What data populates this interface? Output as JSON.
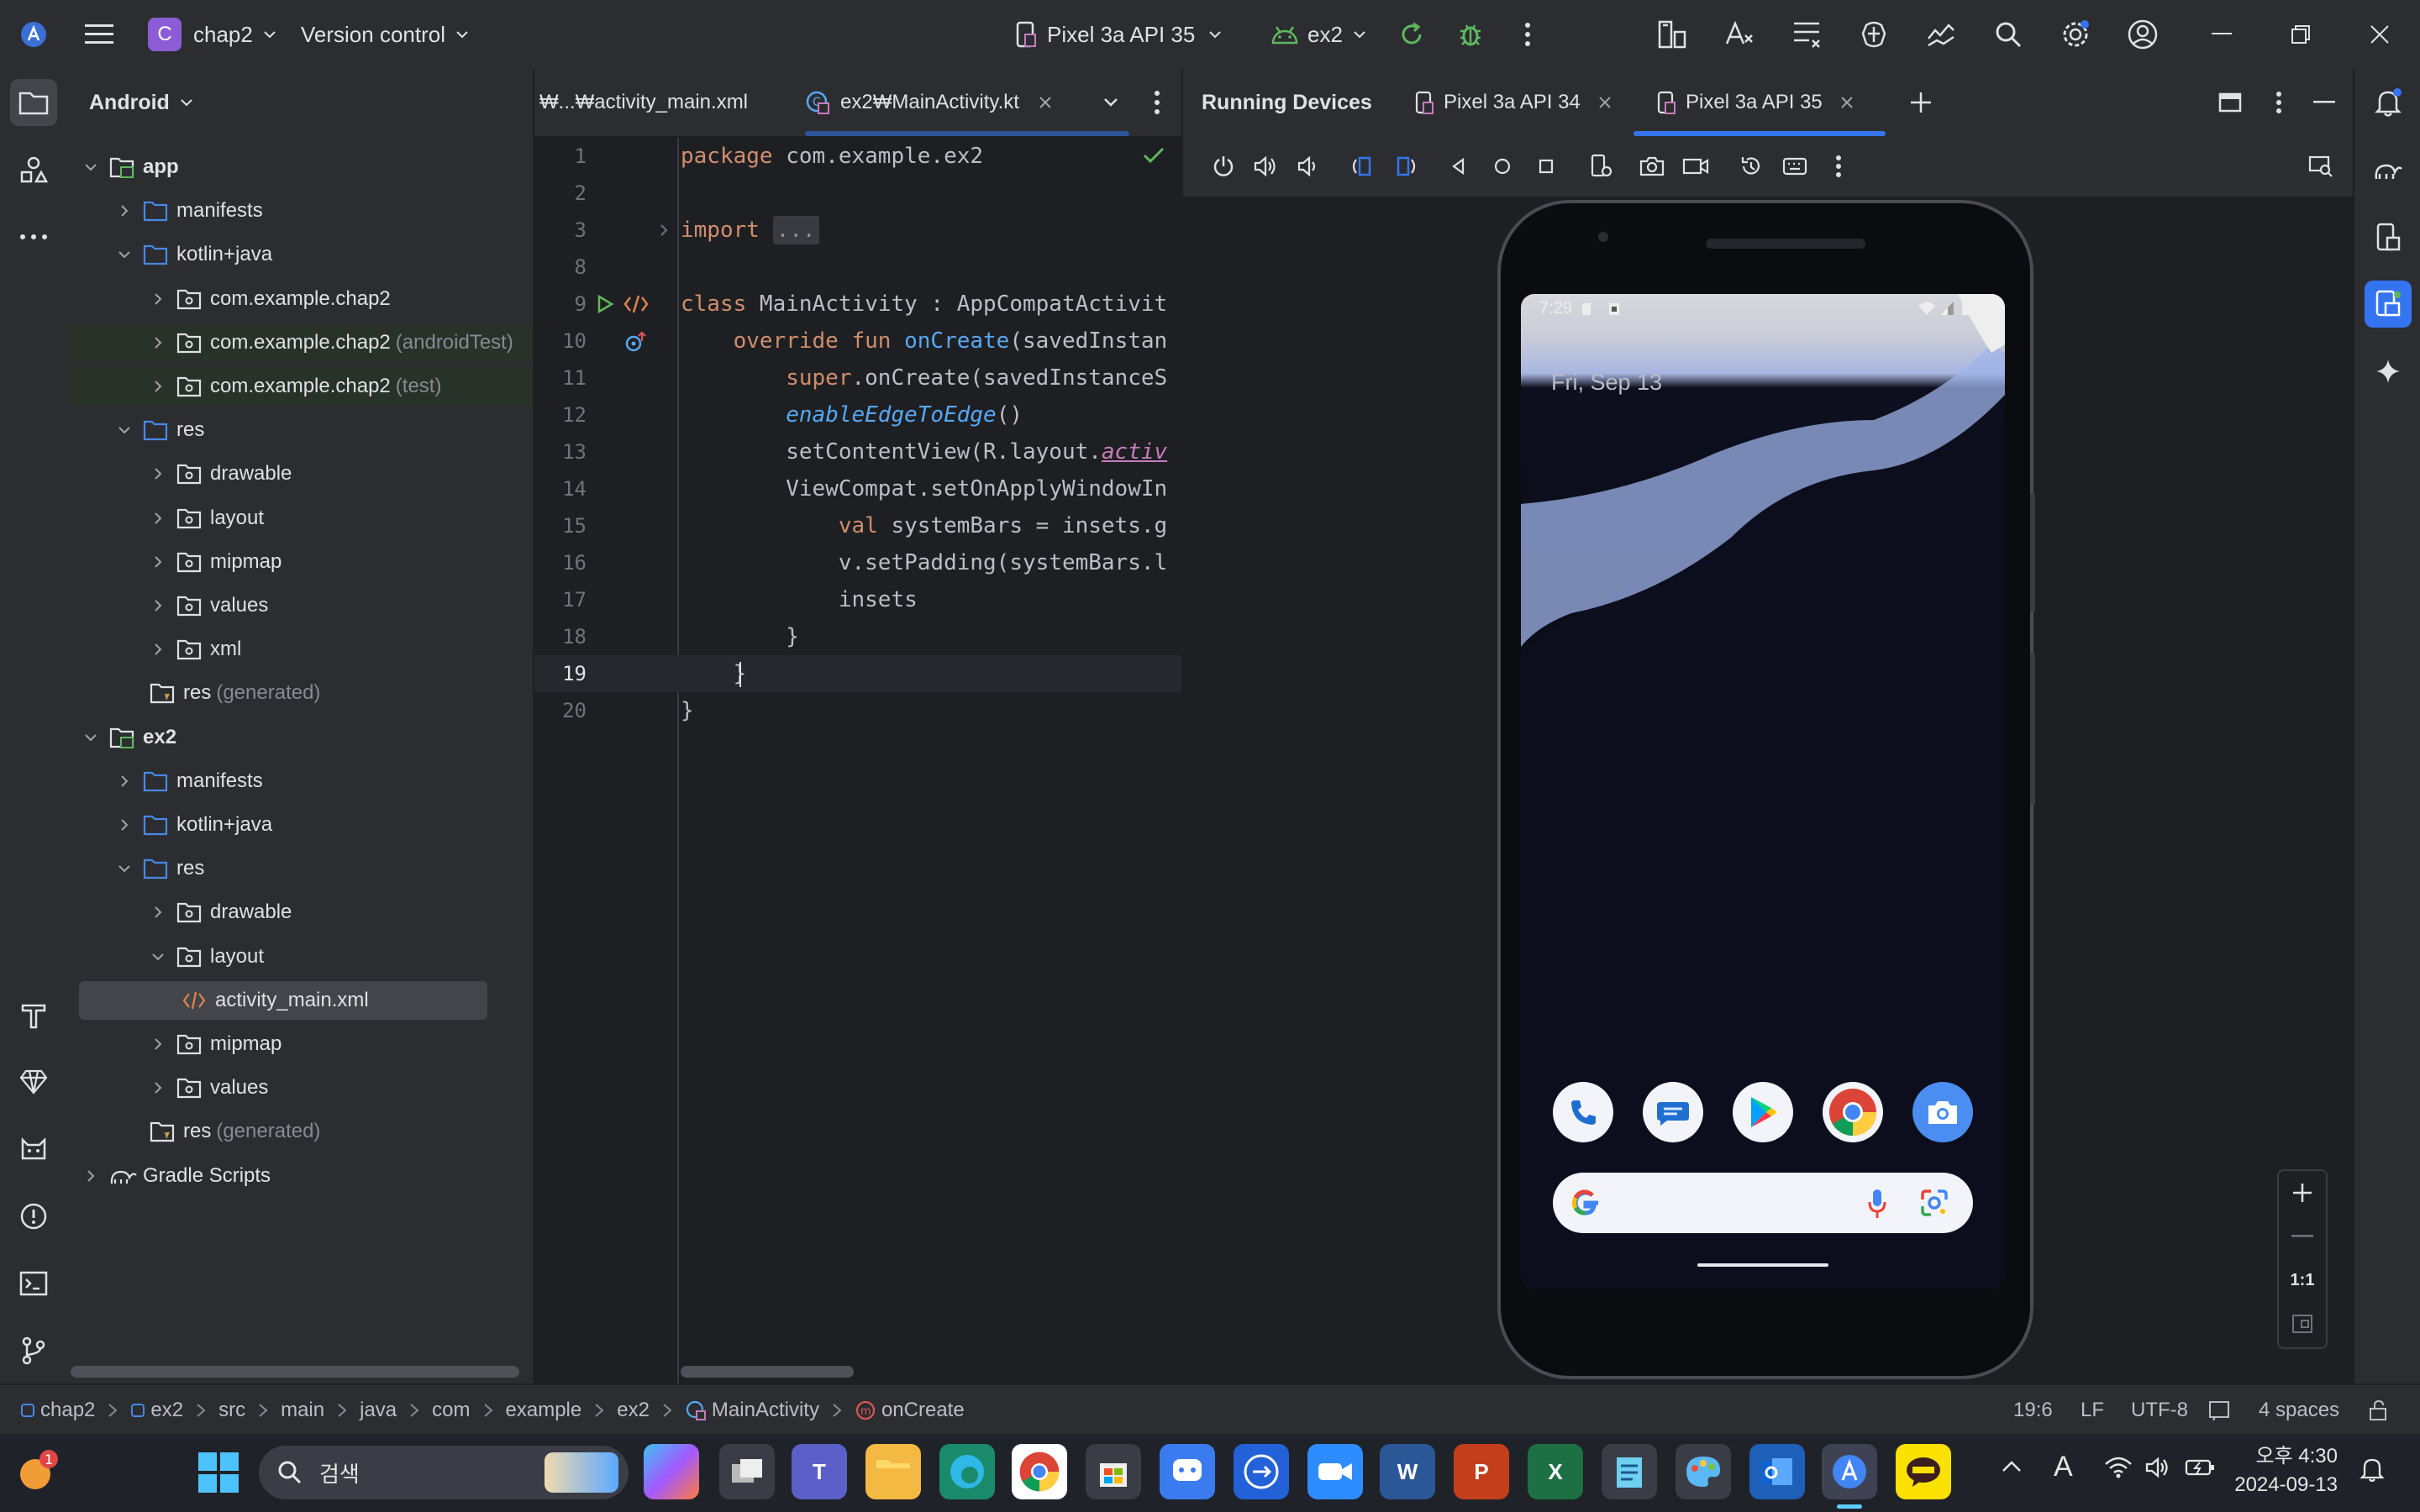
{
  "titlebar": {
    "project_letter": "C",
    "project_name": "chap2",
    "vcs": "Version control",
    "device": "Pixel 3a API 35",
    "run_config": "ex2"
  },
  "project_panel": {
    "view": "Android",
    "tree": [
      {
        "label": "app",
        "suffix": "",
        "bold": true
      },
      {
        "label": "manifests",
        "suffix": ""
      },
      {
        "label": "kotlin+java",
        "suffix": ""
      },
      {
        "label": "com.example.chap2",
        "suffix": ""
      },
      {
        "label": "com.example.chap2",
        "suffix": "(androidTest)"
      },
      {
        "label": "com.example.chap2",
        "suffix": "(test)"
      },
      {
        "label": "res",
        "suffix": ""
      },
      {
        "label": "drawable",
        "suffix": ""
      },
      {
        "label": "layout",
        "suffix": ""
      },
      {
        "label": "mipmap",
        "suffix": ""
      },
      {
        "label": "values",
        "suffix": ""
      },
      {
        "label": "xml",
        "suffix": ""
      },
      {
        "label": "res",
        "suffix": "(generated)"
      },
      {
        "label": "ex2",
        "suffix": "",
        "bold": true
      },
      {
        "label": "manifests",
        "suffix": ""
      },
      {
        "label": "kotlin+java",
        "suffix": ""
      },
      {
        "label": "res",
        "suffix": ""
      },
      {
        "label": "drawable",
        "suffix": ""
      },
      {
        "label": "layout",
        "suffix": ""
      },
      {
        "label": "activity_main.xml",
        "suffix": ""
      },
      {
        "label": "mipmap",
        "suffix": ""
      },
      {
        "label": "values",
        "suffix": ""
      },
      {
        "label": "res",
        "suffix": "(generated)"
      },
      {
        "label": "Gradle Scripts",
        "suffix": ""
      }
    ]
  },
  "editor": {
    "tabs": [
      {
        "label": "₩...₩activity_main.xml"
      },
      {
        "label": "ex2₩MainActivity.kt"
      }
    ],
    "lines": [
      {
        "n": "1"
      },
      {
        "n": "2"
      },
      {
        "n": "3"
      },
      {
        "n": "8"
      },
      {
        "n": "9"
      },
      {
        "n": "10"
      },
      {
        "n": "11"
      },
      {
        "n": "12"
      },
      {
        "n": "13"
      },
      {
        "n": "14"
      },
      {
        "n": "15"
      },
      {
        "n": "16"
      },
      {
        "n": "17"
      },
      {
        "n": "18"
      },
      {
        "n": "19"
      },
      {
        "n": "20"
      }
    ],
    "code": {
      "l1a": "package",
      "l1b": " com.example.ex2",
      "l3a": "import",
      "l3b": "...",
      "l9a": "class",
      "l9b": " MainActivity : AppCompatActivit",
      "l10a": "    override fun ",
      "l10b": "onCreate",
      "l10c": "(savedInstan",
      "l11a": "        super",
      "l11b": ".onCreate(savedInstanceS",
      "l12a": "        ",
      "l12b": "enableEdgeToEdge",
      "l12c": "()",
      "l13a": "        setContentView(R.layout.",
      "l13b": "activ",
      "l14": "        ViewCompat.setOnApplyWindowIn",
      "l15a": "            val",
      "l15b": " systemBars = insets.g",
      "l16": "            v.setPadding(systemBars.l",
      "l17": "            insets",
      "l18": "        }",
      "l19": "    }",
      "l20": "}"
    }
  },
  "devices": {
    "title": "Running Devices",
    "tabs": [
      {
        "label": "Pixel 3a API 34"
      },
      {
        "label": "Pixel 3a API 35"
      }
    ],
    "zoom_label": "1:1",
    "phone": {
      "time": "7:29",
      "date": "Fri, Sep 13"
    }
  },
  "statusbar": {
    "crumbs": [
      "chap2",
      "ex2",
      "src",
      "main",
      "java",
      "com",
      "example",
      "ex2",
      "MainActivity",
      "onCreate"
    ],
    "position": "19:6",
    "line_sep": "LF",
    "encoding": "UTF-8",
    "indent": "4 spaces"
  },
  "taskbar": {
    "search": "검색",
    "badge": "1",
    "ampm_time": "오후 4:30",
    "date": "2024-09-13",
    "lang": "A"
  },
  "colors": {
    "accent": "#3574f0",
    "panel": "#2b2d30",
    "editor_bg": "#1e1f22",
    "selection": "#43454a",
    "test_bg": "#283228"
  }
}
